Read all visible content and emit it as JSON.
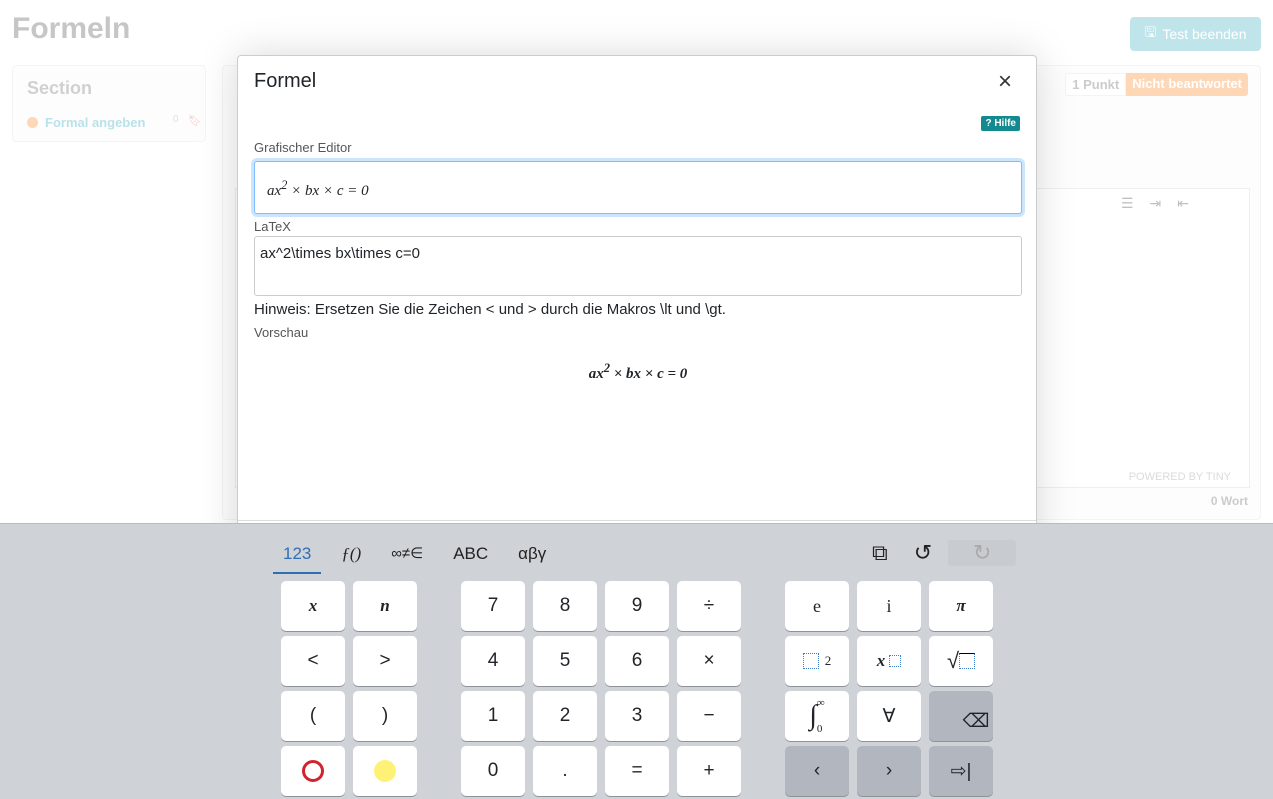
{
  "page": {
    "title": "Formeln",
    "end_button": "Test beenden",
    "section_title": "Section",
    "section_item": "Formal angeben",
    "section_item_count": "0",
    "points": "1 Punkt",
    "status": "Nicht beantwortet",
    "powered": "POWERED BY TINY",
    "word_count": "0 Wort"
  },
  "modal": {
    "title": "Formel",
    "close": "×",
    "help": "Hilfe",
    "graphic_label": "Grafischer Editor",
    "latex_label": "LaTeX",
    "latex_value": "ax^2\\times bx\\times c=0",
    "hint": "Hinweis: Ersetzen Sie die Zeichen < und > durch die Makros \\lt und \\gt.",
    "preview_label": "Vorschau"
  },
  "formula": {
    "a": "ax",
    "exp": "2",
    "rest": " × bx × c = 0"
  },
  "keyboard": {
    "tabs": [
      "123",
      "ƒ()",
      "∞≠∈",
      "ABC",
      "αβγ"
    ],
    "active_tab": "123",
    "keys": {
      "x": "x",
      "n": "n",
      "lt": "<",
      "gt": ">",
      "lp": "(",
      "rp": ")",
      "d7": "7",
      "d8": "8",
      "d9": "9",
      "div": "÷",
      "d4": "4",
      "d5": "5",
      "d6": "6",
      "mul": "×",
      "d1": "1",
      "d2": "2",
      "d3": "3",
      "minus": "−",
      "d0": "0",
      "dot": ".",
      "eq": "=",
      "plus": "+",
      "e": "e",
      "i": "i",
      "pi": "π",
      "sq_exp": "2",
      "forall": "∀",
      "int_upper": "∞",
      "int_lower": "0",
      "left": "‹",
      "right": "›"
    },
    "colors": {
      "red_circle": "#d0242e",
      "yellow_circle": "#fff176",
      "active_tab": "#2f6fb3"
    }
  }
}
